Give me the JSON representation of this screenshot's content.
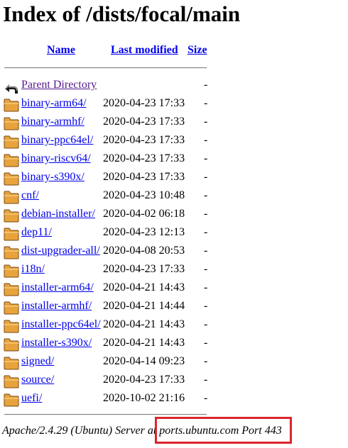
{
  "page_title": "Index of /dists/focal/main",
  "columns": {
    "name": "Name",
    "last_modified": "Last modified",
    "size": "Size"
  },
  "parent": {
    "name": "Parent Directory",
    "size": "-"
  },
  "entries": [
    {
      "name": "binary-arm64/",
      "date": "2020-04-23 17:33",
      "size": "-"
    },
    {
      "name": "binary-armhf/",
      "date": "2020-04-23 17:33",
      "size": "-"
    },
    {
      "name": "binary-ppc64el/",
      "date": "2020-04-23 17:33",
      "size": "-"
    },
    {
      "name": "binary-riscv64/",
      "date": "2020-04-23 17:33",
      "size": "-"
    },
    {
      "name": "binary-s390x/",
      "date": "2020-04-23 17:33",
      "size": "-"
    },
    {
      "name": "cnf/",
      "date": "2020-04-23 10:48",
      "size": "-"
    },
    {
      "name": "debian-installer/",
      "date": "2020-04-02 06:18",
      "size": "-"
    },
    {
      "name": "dep11/",
      "date": "2020-04-23 12:13",
      "size": "-"
    },
    {
      "name": "dist-upgrader-all/",
      "date": "2020-04-08 20:53",
      "size": "-"
    },
    {
      "name": "i18n/",
      "date": "2020-04-23 17:33",
      "size": "-"
    },
    {
      "name": "installer-arm64/",
      "date": "2020-04-21 14:43",
      "size": "-"
    },
    {
      "name": "installer-armhf/",
      "date": "2020-04-21 14:44",
      "size": "-"
    },
    {
      "name": "installer-ppc64el/",
      "date": "2020-04-21 14:43",
      "size": "-"
    },
    {
      "name": "installer-s390x/",
      "date": "2020-04-21 14:43",
      "size": "-"
    },
    {
      "name": "signed/",
      "date": "2020-04-14 09:23",
      "size": "-"
    },
    {
      "name": "source/",
      "date": "2020-04-23 17:33",
      "size": "-"
    },
    {
      "name": "uefi/",
      "date": "2020-10-02 21:16",
      "size": "-"
    }
  ],
  "footer": "Apache/2.4.29 (Ubuntu) Server at ports.ubuntu.com Port 443",
  "icons": {
    "parent": "back-arrow-icon",
    "folder": "folder-icon"
  },
  "colors": {
    "link": "#0000ee",
    "visited": "#551a8b",
    "highlight": "#d9262b"
  }
}
